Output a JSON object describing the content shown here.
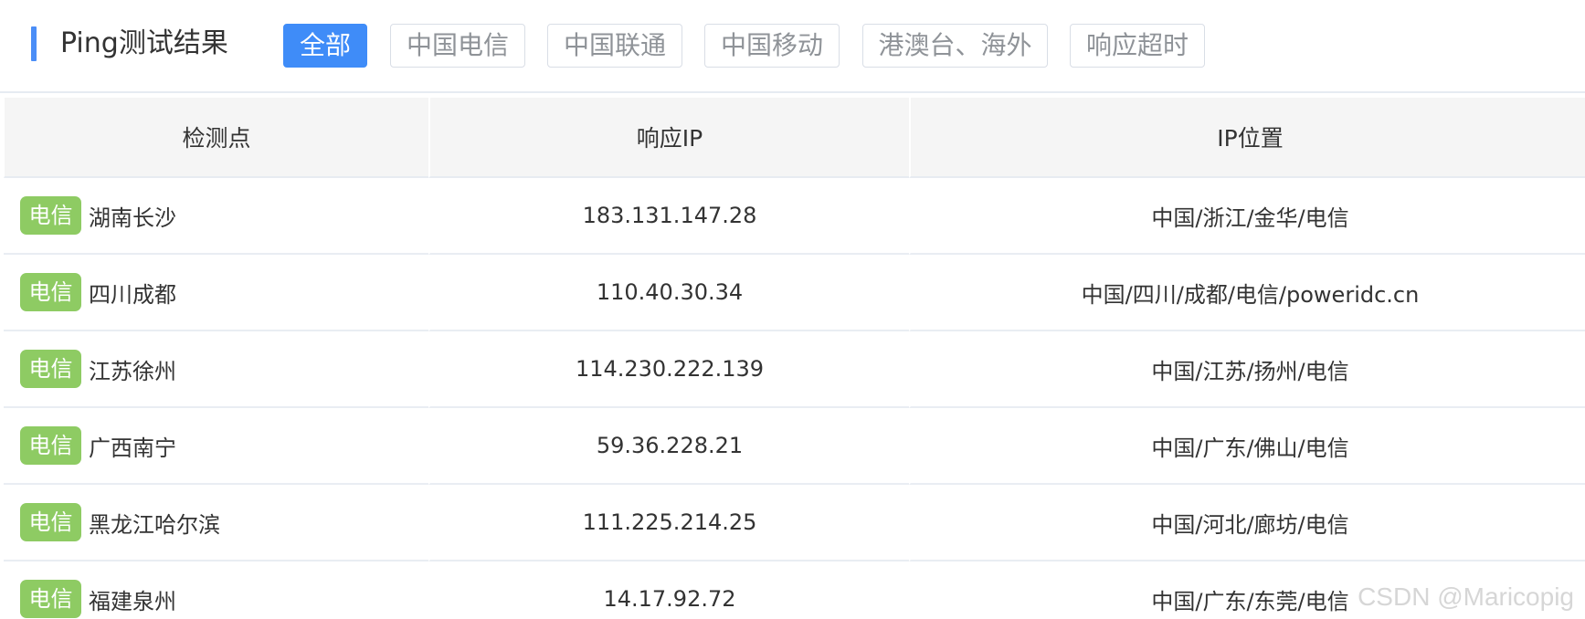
{
  "header": {
    "title": "Ping测试结果",
    "filters": [
      {
        "label": "全部",
        "active": true
      },
      {
        "label": "中国电信",
        "active": false
      },
      {
        "label": "中国联通",
        "active": false
      },
      {
        "label": "中国移动",
        "active": false
      },
      {
        "label": "港澳台、海外",
        "active": false
      },
      {
        "label": "响应超时",
        "active": false
      }
    ],
    "accent_color": "#3f8cf8"
  },
  "table": {
    "columns": [
      "检测点",
      "响应IP",
      "IP位置"
    ],
    "rows": [
      {
        "isp": "电信",
        "node": "湖南长沙",
        "ip": "183.131.147.28",
        "location": "中国/浙江/金华/电信"
      },
      {
        "isp": "电信",
        "node": "四川成都",
        "ip": "110.40.30.34",
        "location": "中国/四川/成都/电信/poweridc.cn"
      },
      {
        "isp": "电信",
        "node": "江苏徐州",
        "ip": "114.230.222.139",
        "location": "中国/江苏/扬州/电信"
      },
      {
        "isp": "电信",
        "node": "广西南宁",
        "ip": "59.36.228.21",
        "location": "中国/广东/佛山/电信"
      },
      {
        "isp": "电信",
        "node": "黑龙江哈尔滨",
        "ip": "111.225.214.25",
        "location": "中国/河北/廊坊/电信"
      },
      {
        "isp": "电信",
        "node": "福建泉州",
        "ip": "14.17.92.72",
        "location": "中国/广东/东莞/电信"
      }
    ],
    "isp_tag_color": "#8ecb63"
  },
  "watermark": "CSDN @Maricopig"
}
